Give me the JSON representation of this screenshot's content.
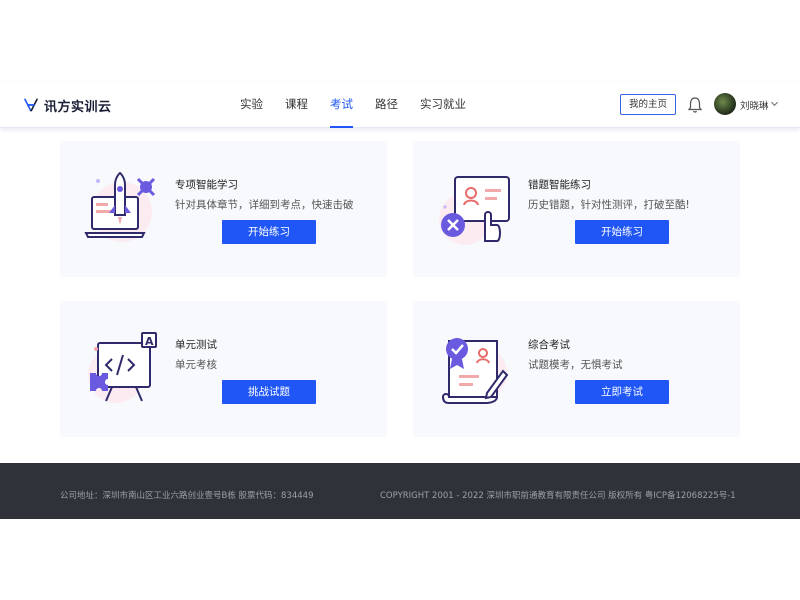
{
  "brand": {
    "name": "讯方实训云"
  },
  "nav": {
    "items": [
      {
        "label": "实验"
      },
      {
        "label": "课程"
      },
      {
        "label": "考试"
      },
      {
        "label": "路径"
      },
      {
        "label": "实习就业"
      }
    ],
    "active_index": 2
  },
  "user_bar": {
    "home_label": "我的主页",
    "user_name": "刘晓琳"
  },
  "cards": [
    {
      "title": "专项智能学习",
      "desc": "针对具体章节，详细到考点，快速击破",
      "button": "开始练习"
    },
    {
      "title": "错题智能练习",
      "desc": "历史错题，针对性测评，打破至酷!",
      "button": "开始练习"
    },
    {
      "title": "单元测试",
      "desc": "单元考核",
      "button": "挑战试题"
    },
    {
      "title": "综合考试",
      "desc": "试题模考，无惧考试",
      "button": "立即考试"
    }
  ],
  "footer": {
    "address": "公司地址：深圳市南山区工业六路创业壹号B栋 股票代码：834449",
    "copyright": "COPYRIGHT 2001 - 2022 深圳市职前通教育有限责任公司 版权所有 粤ICP备12068225号-1"
  },
  "colors": {
    "accent": "#1f56f5",
    "footer_bg": "#2f3238",
    "card_bg": "#f7f9fd"
  },
  "icons": [
    "logo-icon",
    "bell-icon",
    "chevron-down-icon"
  ]
}
